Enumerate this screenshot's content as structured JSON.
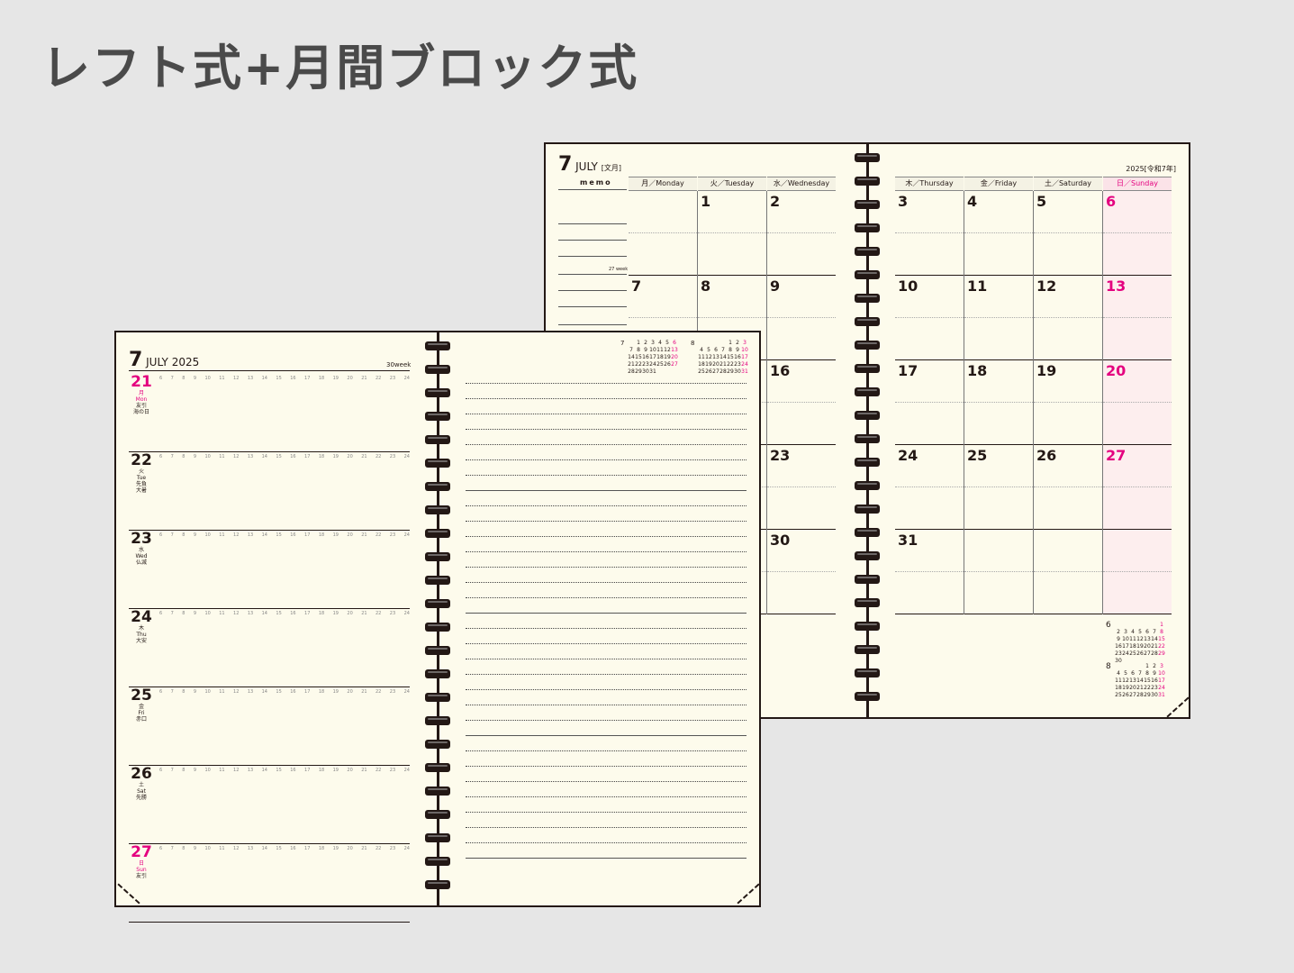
{
  "page_title": "レフト式+月間ブロック式",
  "colors": {
    "background": "#e6e6e6",
    "paper": "#fdfbec",
    "ink": "#231815",
    "sunday": "#e4007f",
    "title": "#4a4a4a"
  },
  "monthly": {
    "month_num": "7",
    "month_en": "JULY",
    "month_jp": "[文月]",
    "year": "2025[令和7年]",
    "memo_label": "memo",
    "week_label": "27 week",
    "left_days": [
      "月／Monday",
      "火／Tuesday",
      "水／Wednesday"
    ],
    "right_days": [
      "木／Thursday",
      "金／Friday",
      "土／Saturday",
      "日／Sunday"
    ],
    "left_cells": [
      [
        "",
        "1",
        "2"
      ],
      [
        "7",
        "8",
        "9"
      ],
      [
        "",
        "",
        "16"
      ],
      [
        "",
        "",
        "23"
      ],
      [
        "",
        "",
        "30"
      ]
    ],
    "right_cells": [
      [
        "3",
        "4",
        "5",
        "6"
      ],
      [
        "10",
        "11",
        "12",
        "13"
      ],
      [
        "17",
        "18",
        "19",
        "20"
      ],
      [
        "24",
        "25",
        "26",
        "27"
      ],
      [
        "31",
        "",
        "",
        ""
      ]
    ],
    "mini_june_label": "6",
    "mini_june": [
      [
        "",
        "",
        "",
        "",
        "",
        "",
        "1"
      ],
      [
        "2",
        "3",
        "4",
        "5",
        "6",
        "7",
        "8"
      ],
      [
        "9",
        "10",
        "11",
        "12",
        "13",
        "14",
        "15"
      ],
      [
        "16",
        "17",
        "18",
        "19",
        "20",
        "21",
        "22"
      ],
      [
        "23",
        "24",
        "25",
        "26",
        "27",
        "28",
        "29"
      ],
      [
        "30",
        "",
        "",
        "",
        "",
        "",
        ""
      ]
    ],
    "mini_aug_label": "8",
    "mini_aug": [
      [
        "",
        "",
        "",
        "",
        "1",
        "2",
        "3"
      ],
      [
        "4",
        "5",
        "6",
        "7",
        "8",
        "9",
        "10"
      ],
      [
        "11",
        "12",
        "13",
        "14",
        "15",
        "16",
        "17"
      ],
      [
        "18",
        "19",
        "20",
        "21",
        "22",
        "23",
        "24"
      ],
      [
        "25",
        "26",
        "27",
        "28",
        "29",
        "30",
        "31"
      ]
    ]
  },
  "weekly": {
    "month_num": "7",
    "month_en": "JULY 2025",
    "week_label": "30week",
    "hours": [
      "6",
      "7",
      "8",
      "9",
      "10",
      "11",
      "12",
      "13",
      "14",
      "15",
      "16",
      "17",
      "18",
      "19",
      "20",
      "21",
      "22",
      "23",
      "24"
    ],
    "days": [
      {
        "d": "21",
        "jp": "月",
        "en": "Mon",
        "rk": "友引",
        "note": "海の日",
        "red": true
      },
      {
        "d": "22",
        "jp": "火",
        "en": "Tue",
        "rk": "先負",
        "note": "大暑",
        "red": false
      },
      {
        "d": "23",
        "jp": "水",
        "en": "Wed",
        "rk": "仏滅",
        "note": "",
        "red": false
      },
      {
        "d": "24",
        "jp": "木",
        "en": "Thu",
        "rk": "大安",
        "note": "",
        "red": false
      },
      {
        "d": "25",
        "jp": "金",
        "en": "Fri",
        "rk": "赤口",
        "note": "",
        "red": false
      },
      {
        "d": "26",
        "jp": "土",
        "en": "Sat",
        "rk": "先勝",
        "note": "",
        "red": false
      },
      {
        "d": "27",
        "jp": "日",
        "en": "Sun",
        "rk": "友引",
        "note": "",
        "red": true
      }
    ],
    "mini_jul_label": "7",
    "mini_jul": [
      [
        "",
        "1",
        "2",
        "3",
        "4",
        "5",
        "6"
      ],
      [
        "7",
        "8",
        "9",
        "10",
        "11",
        "12",
        "13"
      ],
      [
        "14",
        "15",
        "16",
        "17",
        "18",
        "19",
        "20"
      ],
      [
        "21",
        "22",
        "23",
        "24",
        "25",
        "26",
        "27"
      ],
      [
        "28",
        "29",
        "30",
        "31",
        "",
        "",
        ""
      ]
    ],
    "mini_aug_label": "8",
    "mini_aug": [
      [
        "",
        "",
        "",
        "",
        "1",
        "2",
        "3"
      ],
      [
        "4",
        "5",
        "6",
        "7",
        "8",
        "9",
        "10"
      ],
      [
        "11",
        "12",
        "13",
        "14",
        "15",
        "16",
        "17"
      ],
      [
        "18",
        "19",
        "20",
        "21",
        "22",
        "23",
        "24"
      ],
      [
        "25",
        "26",
        "27",
        "28",
        "29",
        "30",
        "31"
      ]
    ]
  }
}
